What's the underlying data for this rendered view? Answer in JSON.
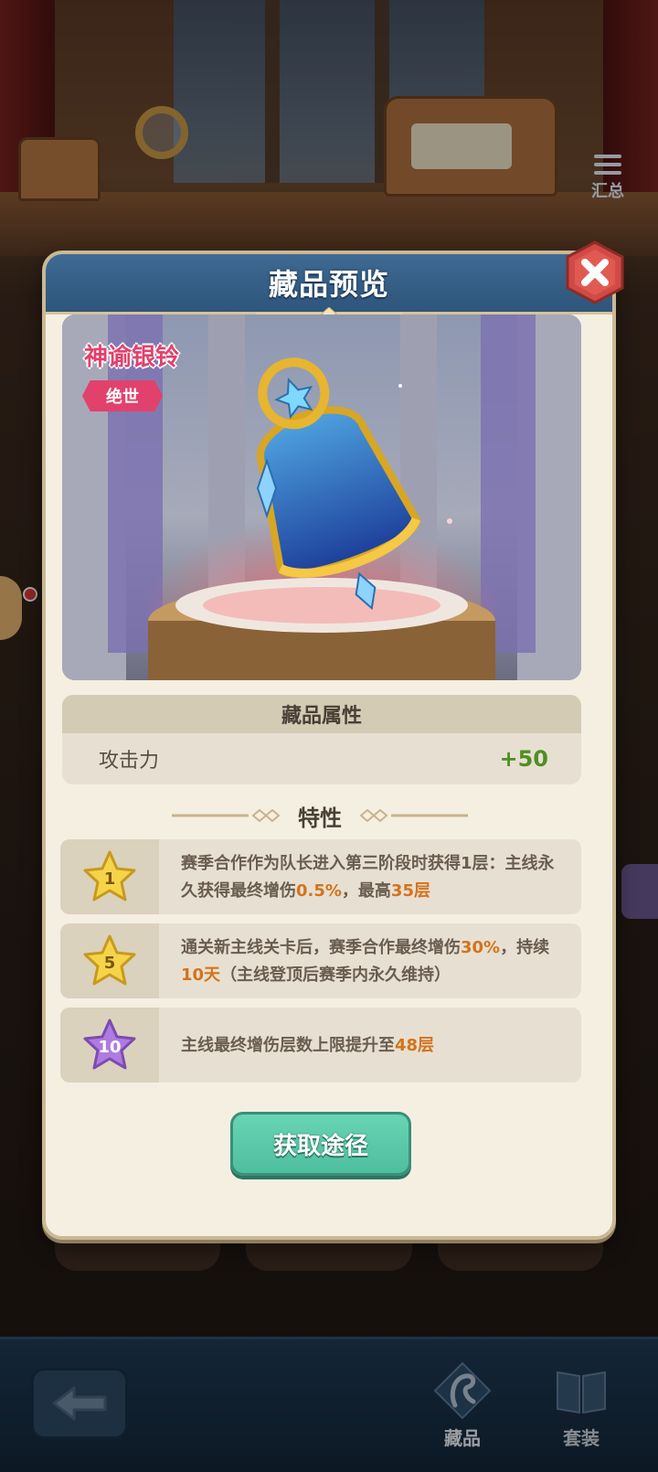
{
  "background": {
    "summary_label": "汇总"
  },
  "modal": {
    "title": "藏品预览",
    "item": {
      "name": "神谕银铃",
      "rarity": "绝世"
    },
    "attributes": {
      "header": "藏品属性",
      "rows": [
        {
          "label": "攻击力",
          "value": "+50"
        }
      ]
    },
    "traits": {
      "title": "特性",
      "items": [
        {
          "star_level": "1",
          "star_color": "gold",
          "segments": [
            {
              "text": "赛季合作作为队长进入第三阶段时获得1层：主线永久获得最终增伤",
              "highlight": false
            },
            {
              "text": "0.5%",
              "highlight": true
            },
            {
              "text": "，最高",
              "highlight": false
            },
            {
              "text": "35层",
              "highlight": true
            }
          ]
        },
        {
          "star_level": "5",
          "star_color": "gold",
          "segments": [
            {
              "text": "通关新主线关卡后，赛季合作最终增伤",
              "highlight": false
            },
            {
              "text": "30%",
              "highlight": true
            },
            {
              "text": "，持续",
              "highlight": false
            },
            {
              "text": "10天",
              "highlight": true
            },
            {
              "text": "（主线登顶后赛季内永久维持）",
              "highlight": false
            }
          ]
        },
        {
          "star_level": "10",
          "star_color": "purple",
          "segments": [
            {
              "text": "主线最终增伤层数上限提升至",
              "highlight": false
            },
            {
              "text": "48层",
              "highlight": true
            }
          ]
        }
      ]
    },
    "obtain_button": "获取途径"
  },
  "bottom_nav": {
    "items": [
      {
        "label": "藏品",
        "icon": "harp-icon",
        "active": true
      },
      {
        "label": "套装",
        "icon": "book-icon",
        "active": false
      }
    ]
  },
  "colors": {
    "header_blue": "#3e6a93",
    "panel_bg": "#f5efe2",
    "rarity_pink": "#e2416c",
    "value_green": "#4f8f22",
    "highlight_orange": "#d4731b",
    "button_teal": "#5ccaa9",
    "close_red": "#d14a45"
  }
}
